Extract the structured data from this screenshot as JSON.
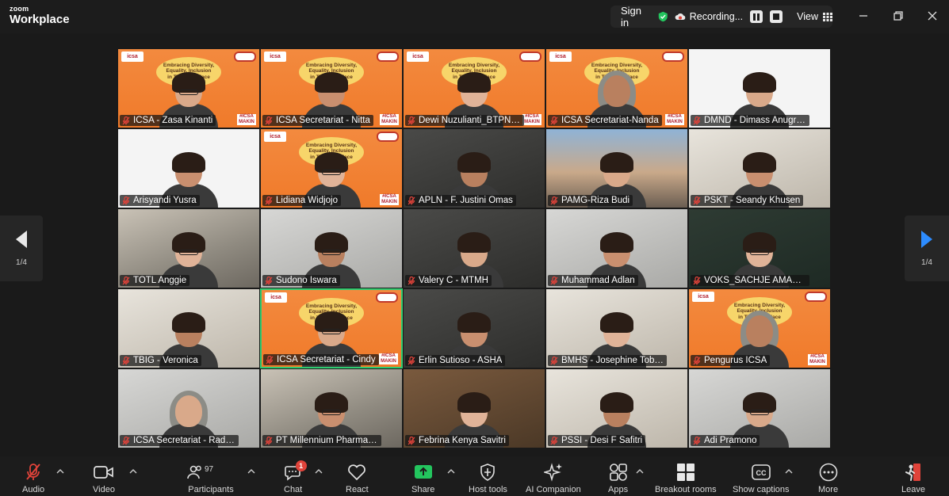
{
  "app": {
    "brand_small": "zoom",
    "brand_large": "Workplace"
  },
  "titlebar": {
    "sign_in": "Sign in",
    "recording": "Recording...",
    "view": "View"
  },
  "pager": {
    "left": "1/4",
    "right": "1/4"
  },
  "banner": {
    "line1": "Embracing Diversity,",
    "line2": "Equality, Inclusion",
    "line3": "in The Workplace",
    "logo": "icsa",
    "hashtag": "#ICSA MAKIN"
  },
  "tiles": [
    {
      "name": "ICSA - Zasa Kinanti",
      "bg": "orange",
      "banner": true
    },
    {
      "name": "ICSA Secretariat - Nitta",
      "bg": "orange",
      "banner": true
    },
    {
      "name": "Dewi Nuzulianti_BTPN Syari...",
      "bg": "orange",
      "banner": true
    },
    {
      "name": "ICSA Secretariat-Nanda",
      "bg": "orange",
      "banner": true
    },
    {
      "name": "DMND - Dimass Anugrah A",
      "bg": "white",
      "banner": false
    },
    {
      "name": "Arisyandi Yusra",
      "bg": "white",
      "banner": false
    },
    {
      "name": "Lidiana Widjojo",
      "bg": "orange",
      "banner": true
    },
    {
      "name": "APLN - F. Justini Omas",
      "bg": "dark",
      "banner": false
    },
    {
      "name": "PAMG-Riza Budi",
      "bg": "city",
      "banner": false
    },
    {
      "name": "PSKT - Seandy Khusen",
      "bg": "room",
      "banner": false
    },
    {
      "name": "TOTL Anggie",
      "bg": "office",
      "banner": false
    },
    {
      "name": "Sudono Iswara",
      "bg": "grey",
      "banner": false
    },
    {
      "name": "Valery C - MTMH",
      "bg": "dark",
      "banner": false
    },
    {
      "name": "Muhammad Adlan",
      "bg": "grey",
      "banner": false
    },
    {
      "name": "VOKS_SACHJE AMALIA SIDD...",
      "bg": "green",
      "banner": false
    },
    {
      "name": "TBIG - Veronica",
      "bg": "room",
      "banner": false
    },
    {
      "name": "ICSA Secretariat - Cindy",
      "bg": "orange",
      "banner": true
    },
    {
      "name": "Erlin Sutioso - ASHA",
      "bg": "dark",
      "banner": false
    },
    {
      "name": "BMHS - Josephine Tobing",
      "bg": "room",
      "banner": false
    },
    {
      "name": "Pengurus ICSA",
      "bg": "orange",
      "banner": true
    },
    {
      "name": "ICSA Secretariat - Radha",
      "bg": "grey",
      "banner": false
    },
    {
      "name": "PT Millennium Pharmacon I...",
      "bg": "office",
      "banner": false
    },
    {
      "name": "Febrina Kenya Savitri",
      "bg": "wood",
      "banner": false
    },
    {
      "name": "PSSI - Desi F Safitri",
      "bg": "room",
      "banner": false
    },
    {
      "name": "Adi Pramono",
      "bg": "grey",
      "banner": false
    }
  ],
  "toolbar": {
    "audio": "Audio",
    "video": "Video",
    "participants": "Participants",
    "participants_count": "97",
    "chat": "Chat",
    "chat_badge": "1",
    "react": "React",
    "share": "Share",
    "host_tools": "Host tools",
    "ai_companion": "AI Companion",
    "apps": "Apps",
    "breakout_rooms": "Breakout rooms",
    "show_captions": "Show captions",
    "more": "More",
    "leave": "Leave"
  },
  "colors": {
    "accent_green": "#2ecc71",
    "leave_red": "#e0433a",
    "share_green": "#23c55e",
    "pager_blue": "#2d8cff"
  }
}
